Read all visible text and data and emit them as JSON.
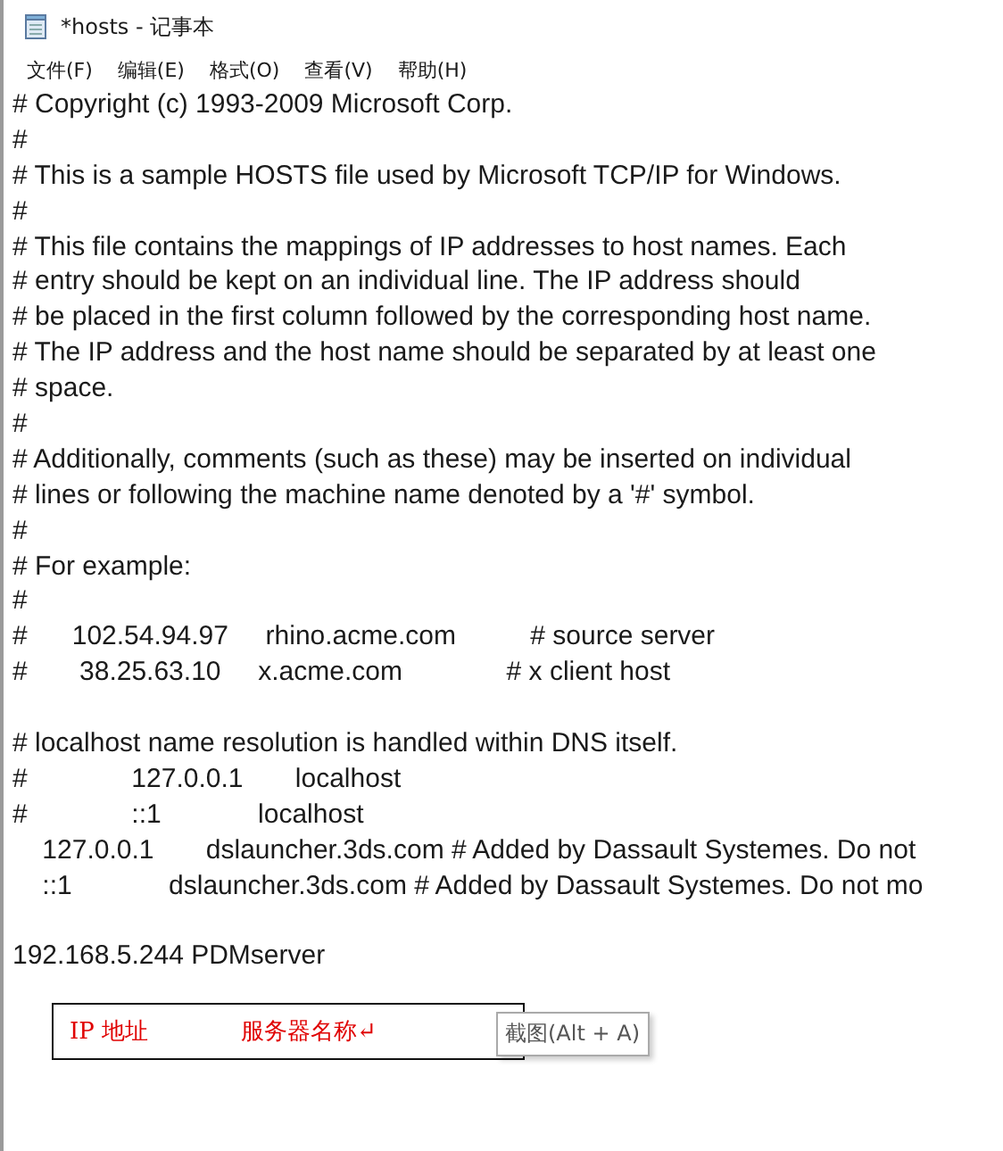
{
  "window": {
    "title": "*hosts - 记事本"
  },
  "menu": [
    "文件(F)",
    "编辑(E)",
    "格式(O)",
    "查看(V)",
    "帮助(H)"
  ],
  "lines": [
    {
      "kind": "text",
      "text": "# Copyright (c) 1993-2009 Microsoft Corp."
    },
    {
      "kind": "text",
      "text": "#"
    },
    {
      "kind": "text",
      "text": "# This is a sample HOSTS file used by Microsoft TCP/IP for Windows."
    },
    {
      "kind": "text",
      "text": "#"
    },
    {
      "kind": "text",
      "text": "# This file contains the mappings of IP addresses to host names. Each"
    },
    {
      "kind": "text",
      "text": "# entry should be kept on an individual line. The IP address should"
    },
    {
      "kind": "text",
      "text": "# be placed in the first column followed by the corresponding host name."
    },
    {
      "kind": "text",
      "text": "# The IP address and the host name should be separated by at least one"
    },
    {
      "kind": "text",
      "text": "# space."
    },
    {
      "kind": "text",
      "text": "#"
    },
    {
      "kind": "text",
      "text": "# Additionally, comments (such as these) may be inserted on individual"
    },
    {
      "kind": "text",
      "text": "# lines or following the machine name denoted by a '#' symbol."
    },
    {
      "kind": "text",
      "text": "#"
    },
    {
      "kind": "text",
      "text": "# For example:"
    },
    {
      "kind": "text",
      "text": "#"
    },
    {
      "kind": "text",
      "text": "#      102.54.94.97     rhino.acme.com          # source server"
    },
    {
      "kind": "text",
      "text": "#       38.25.63.10     x.acme.com              # x client host"
    },
    {
      "kind": "blank"
    },
    {
      "kind": "text",
      "text": "# localhost name resolution is handled within DNS itself."
    },
    {
      "kind": "text",
      "text": "#              127.0.0.1       localhost"
    },
    {
      "kind": "text",
      "text": "#              ::1             localhost"
    },
    {
      "kind": "text",
      "text": "    127.0.0.1       dslauncher.3ds.com # Added by Dassault Systemes. Do not"
    },
    {
      "kind": "text",
      "text": "    ::1             dslauncher.3ds.com # Added by Dassault Systemes. Do not mo"
    },
    {
      "kind": "blank"
    },
    {
      "kind": "text",
      "text": "192.168.5.244 PDMserver"
    }
  ],
  "note": {
    "ip_label": "IP 地址",
    "server_label": "服务器名称↵"
  },
  "tooltip": "截图(Alt + A)"
}
